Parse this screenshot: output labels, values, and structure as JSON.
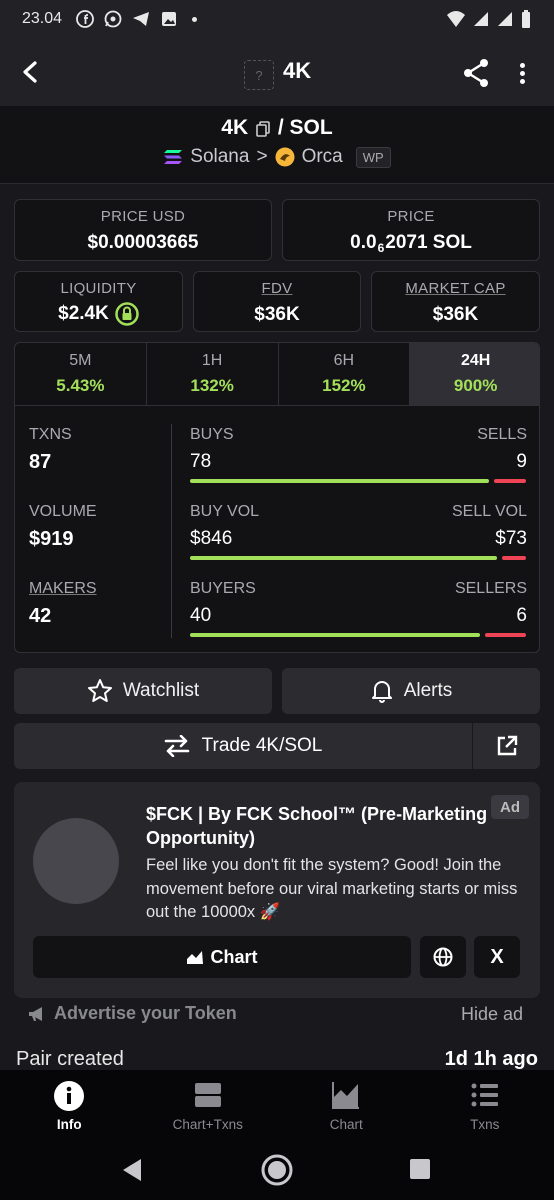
{
  "status_bar": {
    "time": "23.04"
  },
  "top_bar": {
    "logo_placeholder": "?",
    "title": "4K"
  },
  "pair": {
    "base": "4K",
    "separator": "/ SOL",
    "chain": "Solana",
    "chevron": ">",
    "dex": "Orca",
    "badge": "WP"
  },
  "stats": {
    "price_usd": {
      "label": "PRICE USD",
      "value": "$0.00003665"
    },
    "price": {
      "label": "PRICE",
      "prefix": "0.0",
      "sub": "6",
      "suffix": "2071 SOL"
    },
    "liquidity": {
      "label": "LIQUIDITY",
      "value": "$2.4K"
    },
    "fdv": {
      "label": "FDV",
      "value": "$36K"
    },
    "market_cap": {
      "label": "MARKET CAP",
      "value": "$36K"
    }
  },
  "timeframes": [
    {
      "label": "5M",
      "change": "5.43%"
    },
    {
      "label": "1H",
      "change": "132%"
    },
    {
      "label": "6H",
      "change": "152%"
    },
    {
      "label": "24H",
      "change": "900%"
    }
  ],
  "activity": {
    "txns": {
      "label": "TXNS",
      "value": "87",
      "left_label": "BUYS",
      "left_value": "78",
      "right_label": "SELLS",
      "right_value": "9",
      "left_fraction": 0.897
    },
    "volume": {
      "label": "VOLUME",
      "value": "$919",
      "left_label": "BUY VOL",
      "left_value": "$846",
      "right_label": "SELL VOL",
      "right_value": "$73",
      "left_fraction": 0.92
    },
    "makers": {
      "label": "MAKERS",
      "value": "42",
      "left_label": "BUYERS",
      "left_value": "40",
      "right_label": "SELLERS",
      "right_value": "6",
      "left_fraction": 0.87
    }
  },
  "actions": {
    "watchlist": "Watchlist",
    "alerts": "Alerts",
    "trade": "Trade 4K/SOL"
  },
  "ad": {
    "tag": "Ad",
    "title": "$FCK | By FCK School™ (Pre-Marketing Opportunity)",
    "description": "Feel like you don't fit the system? Good! Join the movement before our viral marketing starts or miss out the 10000x 🚀",
    "chart_button": "Chart",
    "x_button": "X"
  },
  "advertise_label": "Advertise your Token",
  "hide_ad": "Hide ad",
  "pair_created": {
    "label": "Pair created",
    "value": "1d 1h ago"
  },
  "bottom_nav": [
    {
      "label": "Info",
      "icon": "info-icon",
      "active": true
    },
    {
      "label": "Chart+Txns",
      "icon": "split-view-icon",
      "active": false
    },
    {
      "label": "Chart",
      "icon": "chart-icon",
      "active": false
    },
    {
      "label": "Txns",
      "icon": "list-icon",
      "active": false
    }
  ],
  "colors": {
    "positive": "#a3e05a",
    "negative": "#ee4455",
    "background": "#19191d",
    "panel": "#121215"
  }
}
